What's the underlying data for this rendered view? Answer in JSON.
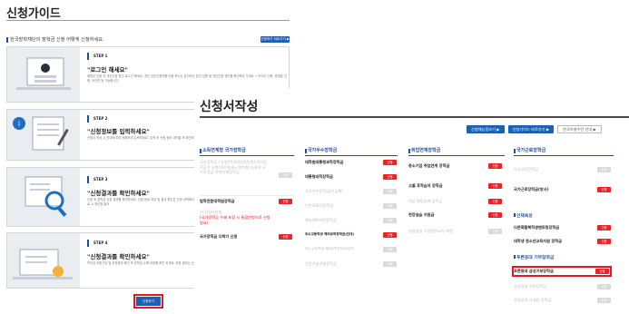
{
  "guide": {
    "title": "신청가이드",
    "intro": "한국장학재단의 장학금 신청 어떻게 신청하세요.",
    "top_btn": "신청하기 바로가기 ▶",
    "apply_btn": "신청하기",
    "steps": [
      {
        "badge": "STEP 1",
        "title": "\"로그인 해세요\"",
        "desc": "회원은 신청 전 개인인증 본인 로그인 해세요. 개인 공인인증서를 이용 하시는 분이라는 본인 인증 및 개인인증 정보를 확인하여 주세요. * 아이디 인증, 휴대폰 인증, 아이핀 등 가능합니다."
      },
      {
        "badge": "STEP 2",
        "title": "\"신청정보를 입력하세요\"",
        "desc": "신청서 작성 시 안내에 따라 정확하게 입력하세요. 입력 후 신청 정보 내역을 꼭 확인하세요. * 제출서류 등록을 완료하세요."
      },
      {
        "badge": "STEP 3",
        "title": "\"신청결과를 확인하세요\"",
        "desc": "신청 후 장학금 신청 결과를 확인하세요. 신청 완료 여부 및 결과 확인은 신청 내역에서 확인할 수 있습니다. * 신청 결과 조회 : 신청내역 > 신청결과 조회 * 미완료 시 재신청 필요"
      },
      {
        "badge": "STEP 4",
        "title": "\"신청결과를 확인하세요\"",
        "desc": "학자금 지원구분 및 지원결과 확인 후 장학금 수혜 여부를 확인 하세요. 최종 결과는 신청하신 내역에서 확인 가능합니다."
      }
    ]
  },
  "form": {
    "title": "신청서작성",
    "buttons": [
      "신청해능힘보기 ▶",
      "신청가이드 바로가기 ▶",
      "한국어영수탄 안내 ▶"
    ],
    "col1": {
      "head": "소득연계형 국가장학금",
      "items": [
        {
          "t": "국가장학금 I 유형(학생직접지원형) 국가장학금 II 유형(대학자체노력연계) 다자녀 국가장학금 지역인재장학금",
          "s": "off",
          "b": "신청"
        },
        {
          "t": "법학전문대학원장학금",
          "s": "on",
          "b": "신청"
        },
        {
          "t": "의·전임의지원",
          "s": "off",
          "b": ""
        },
        {
          "t": "(국가장학금 수혜 포함 시 통합신청으로 신청 필요)",
          "s": "red",
          "b": ""
        },
        {
          "t": "국가장학금 다락기 신청",
          "s": "on",
          "b": "신청"
        }
      ]
    },
    "col2": {
      "head": "국가우수장학금",
      "items": [
        {
          "t": "대학원대통령과학장학금",
          "s": "on",
          "b": "신청"
        },
        {
          "t": "대통령과학장학금",
          "s": "on",
          "b": "신청"
        },
        {
          "t": "국가우수장학금(이공계)",
          "s": "off",
          "b": "신청"
        },
        {
          "t": "인문100년장학금",
          "s": "off",
          "b": "신청"
        },
        {
          "t": "예술체육비전장학금",
          "s": "off",
          "b": "신청"
        },
        {
          "t": "우수고등학생 해외유학장학금(단대)",
          "s": "on",
          "b": "신청"
        },
        {
          "t": "우수 고등학생 해외유학장학금(광역)",
          "s": "off",
          "b": "신청"
        },
        {
          "t": "전문기술인재장학금",
          "s": "off",
          "b": "신청"
        }
      ]
    },
    "col3": {
      "head": "취업연계장학금",
      "items": [
        {
          "t": "중소기업 취업연계 장학금",
          "s": "on",
          "b": "신청"
        },
        {
          "t": "고졸 후학습자 장학금",
          "s": "on",
          "b": "신청"
        },
        {
          "t": "기업 취업연계 장학금",
          "s": "off",
          "b": "신청"
        },
        {
          "t": "현장실습 지원금",
          "s": "on",
          "b": "신청"
        },
        {
          "t": "현장실습 기업현장교사 지원",
          "s": "off",
          "b": "신청"
        }
      ]
    },
    "col4": {
      "head": "국가근로장학금",
      "items": [
        {
          "t": "국가근로장학금",
          "s": "off",
          "b": "신청"
        },
        {
          "t": "국가근로장학금(방사)",
          "s": "on",
          "b": "신청"
        }
      ],
      "sub1": "인재육성",
      "sub1_items": [
        {
          "t": "다문화탈북학생멘토링장학금",
          "s": "on",
          "b": "신청"
        },
        {
          "t": "대학생 청소년교육지원 장학금",
          "s": "on",
          "b": "신청"
        }
      ],
      "sub2": "푸른등대 기부장학금",
      "sub2_items": [
        {
          "t": "푸른등대 삼성기부장학금",
          "s": "on",
          "b": "신청"
        },
        {
          "t": "푸른등대 기부장학금",
          "s": "off",
          "b": "신청"
        },
        {
          "t": "푸른등대 유네용 장학금",
          "s": "off",
          "b": "신청"
        }
      ]
    }
  }
}
